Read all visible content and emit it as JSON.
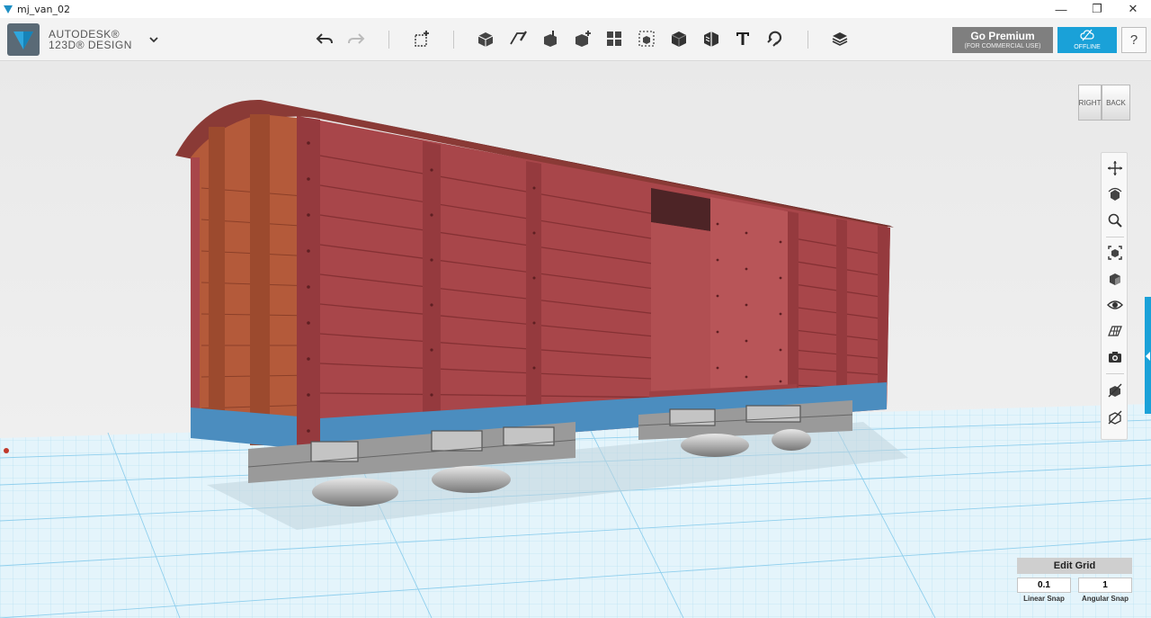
{
  "window": {
    "title": "mj_van_02",
    "controls": [
      "—",
      "❐",
      "✕"
    ]
  },
  "brand": {
    "line1": "AUTODESK®",
    "line2": "123D® DESIGN"
  },
  "toolbar": {
    "tools": [
      {
        "name": "undo-icon"
      },
      {
        "name": "redo-icon"
      },
      {
        "name": "primitives-icon"
      },
      {
        "name": "sketch-icon"
      },
      {
        "name": "construct-icon"
      },
      {
        "name": "modify-icon"
      },
      {
        "name": "pattern-icon"
      },
      {
        "name": "group-icon"
      },
      {
        "name": "combine-icon"
      },
      {
        "name": "measure-icon"
      },
      {
        "name": "text-icon"
      },
      {
        "name": "snap-icon"
      },
      {
        "name": "material-icon"
      },
      {
        "name": "layers-icon"
      }
    ]
  },
  "premium": {
    "title": "Go Premium",
    "subtitle": "(FOR COMMERCIAL USE)"
  },
  "offline": {
    "label": "OFFLINE"
  },
  "help": {
    "label": "?"
  },
  "viewcube": {
    "left": "RIGHT",
    "right": "BACK"
  },
  "nav": {
    "items": [
      "pan-icon",
      "orbit-icon",
      "zoom-icon",
      "fit-icon",
      "view-icon",
      "visibility-icon",
      "grid-icon",
      "camera-icon",
      "materials-icon",
      "outline-icon"
    ]
  },
  "edit_grid": {
    "title": "Edit Grid",
    "linear_snap": "0.1",
    "angular_snap": "1",
    "linear_label": "Linear Snap",
    "angular_label": "Angular Snap"
  },
  "colors": {
    "accent": "#1aa1d8",
    "body": "#a8464a",
    "base": "#4b8dbf",
    "grid": "#9fd6ef"
  }
}
